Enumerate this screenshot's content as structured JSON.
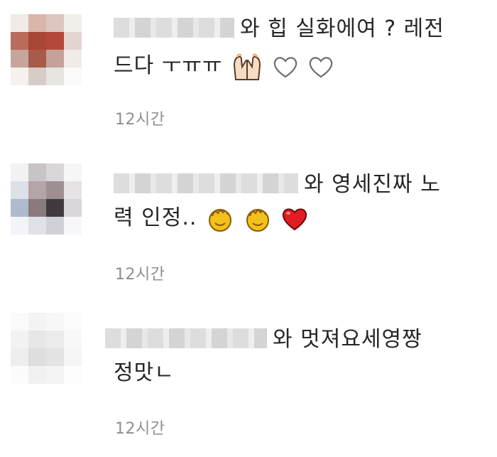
{
  "comments": [
    {
      "avatar_colors": [
        "#f0ebe7",
        "#d9b5aa",
        "#dcc6bf",
        "#f2eeea",
        "#b96b5c",
        "#a84637",
        "#b5483a",
        "#e4d4cf",
        "#c6a69c",
        "#a75c49",
        "#c4a29a",
        "#f1ebe7",
        "#f4f1ee",
        "#d7cdc6",
        "#e8e4df",
        "#fbfaf8"
      ],
      "text_line1": "와 힙 실화에여 ? 레전",
      "text_line2": "드다 ㅜㅠㅠ",
      "emojis": [
        "raising-hands-icon",
        "white-heart-icon",
        "white-heart-icon"
      ],
      "time": "12시간"
    },
    {
      "avatar_colors": [
        "#f2f2f4",
        "#c8c3c6",
        "#d9d6d9",
        "#f6f6f7",
        "#dde0e7",
        "#b3a5a8",
        "#9e9092",
        "#e6e3e6",
        "#aebacd",
        "#8a7a7b",
        "#403a40",
        "#d8d6db",
        "#f3f4f8",
        "#dfe1e8",
        "#cfd0d8",
        "#f7f7f9"
      ],
      "text_line1": "와 영세진짜 노",
      "text_line2": "력 인정..",
      "emojis": [
        "clapping-hands-icon",
        "clapping-hands-icon",
        "red-heart-icon"
      ],
      "time": "12시간"
    },
    {
      "avatar_colors": [
        "#fafafa",
        "#f3f3f3",
        "#f7f7f7",
        "#fcfcfc",
        "#f2f2f2",
        "#e6e6e6",
        "#ebebeb",
        "#f8f8f8",
        "#eeeeee",
        "#dedede",
        "#e3e3e3",
        "#f5f5f5",
        "#fbfbfb",
        "#f0f0f0",
        "#f4f4f4",
        "#fdfdfd"
      ],
      "text_line1": "와 멋져요세영짱",
      "text_line2": "정맛ㄴ",
      "emojis": [],
      "time": "12시간"
    }
  ]
}
